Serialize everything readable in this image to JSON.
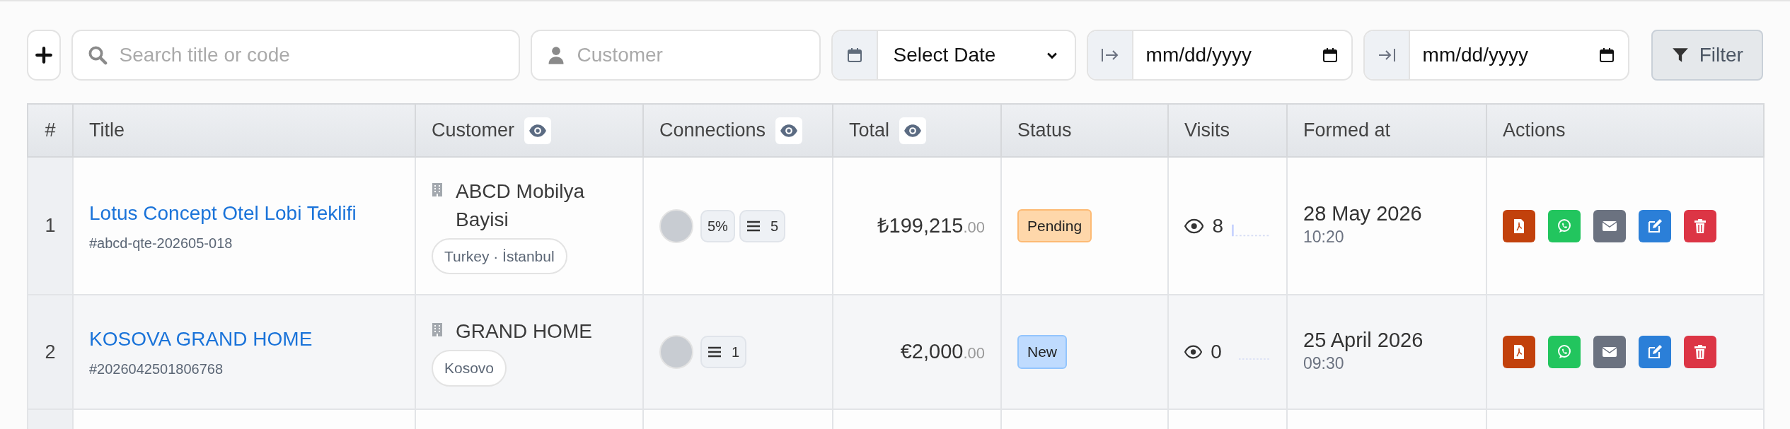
{
  "toolbar": {
    "search": {
      "placeholder": "Search title or code"
    },
    "customer": {
      "placeholder": "Customer"
    },
    "date_select": {
      "value": "Select Date"
    },
    "date_from": {
      "placeholder": "mm/dd/yyyy"
    },
    "date_to": {
      "placeholder": "mm/dd/yyyy"
    },
    "filter_button": "Filter"
  },
  "table": {
    "columns": [
      {
        "label": "#",
        "eye": false
      },
      {
        "label": "Title",
        "eye": false
      },
      {
        "label": "Customer",
        "eye": true
      },
      {
        "label": "Connections",
        "eye": true
      },
      {
        "label": "Total",
        "eye": true
      },
      {
        "label": "Status",
        "eye": false
      },
      {
        "label": "Visits",
        "eye": false
      },
      {
        "label": "Formed at",
        "eye": false
      },
      {
        "label": "Actions",
        "eye": false
      }
    ],
    "rows": [
      {
        "index": "1",
        "title": "Lotus Concept Otel Lobi Teklifi",
        "code": "#abcd-qte-202605-018",
        "customer": "ABCD Mobilya Bayisi",
        "location": "Turkey · İstanbul",
        "percent": "5%",
        "count": "5",
        "amount": "₺199,215",
        "decimals": ".00",
        "status": {
          "label": "Pending",
          "kind": "pending"
        },
        "visits": "8",
        "date": "28 May 2026",
        "time": "10:20"
      },
      {
        "index": "2",
        "title": "KOSOVA GRAND HOME",
        "code": "#2026042501806768",
        "customer": "GRAND HOME",
        "location": "Kosovo",
        "count": "1",
        "amount": "€2,000",
        "decimals": ".00",
        "status": {
          "label": "New",
          "kind": "new"
        },
        "visits": "0",
        "date": "25 April 2026",
        "time": "09:30"
      }
    ]
  }
}
